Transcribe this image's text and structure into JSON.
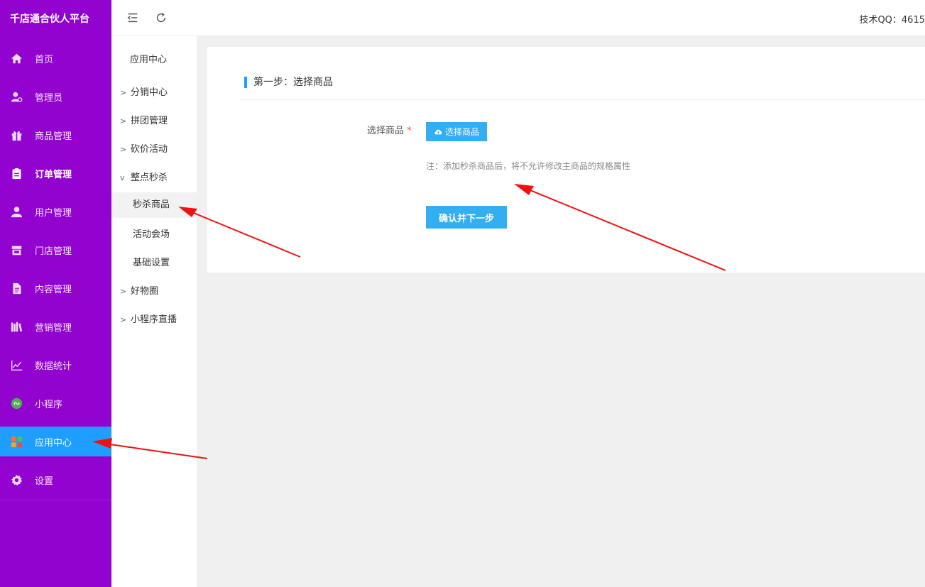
{
  "brand": "千店通合伙人平台",
  "sidebar": {
    "items": [
      {
        "label": "首页",
        "icon": "home-icon"
      },
      {
        "label": "管理员",
        "icon": "admin-icon"
      },
      {
        "label": "商品管理",
        "icon": "gift-icon"
      },
      {
        "label": "订单管理",
        "icon": "clipboard-icon"
      },
      {
        "label": "用户管理",
        "icon": "user-icon"
      },
      {
        "label": "门店管理",
        "icon": "store-icon"
      },
      {
        "label": "内容管理",
        "icon": "document-icon"
      },
      {
        "label": "营销管理",
        "icon": "books-icon"
      },
      {
        "label": "数据统计",
        "icon": "line-chart-icon"
      },
      {
        "label": "小程序",
        "icon": "miniprogram-icon"
      },
      {
        "label": "应用中心",
        "icon": "apps-icon"
      },
      {
        "label": "设置",
        "icon": "gear-icon"
      }
    ],
    "active_index": 10
  },
  "subnav": {
    "title": "应用中心",
    "items": [
      {
        "label": "分销中心",
        "chevron": ">"
      },
      {
        "label": "拼团管理",
        "chevron": ">"
      },
      {
        "label": "砍价活动",
        "chevron": ">"
      },
      {
        "label": "整点秒杀",
        "chevron": "v"
      },
      {
        "label": "秒杀商品"
      },
      {
        "label": "活动会场"
      },
      {
        "label": "基础设置"
      },
      {
        "label": "好物圈",
        "chevron": ">"
      },
      {
        "label": "小程序直播",
        "chevron": ">"
      }
    ]
  },
  "header": {
    "tech_qq": "技术QQ：4615"
  },
  "main": {
    "step_title": "第一步：选择商品",
    "field_label": "选择商品",
    "required_mark": "*",
    "select_button": "选择商品",
    "note": "注：添加秒杀商品后，将不允许修改主商品的规格属性",
    "confirm_button": "确认并下一步"
  },
  "colors": {
    "sidebar_bg": "#9303cf",
    "active_bg": "#1e9fff",
    "button_bg": "#33aef0",
    "arrow": "#ee1111"
  }
}
